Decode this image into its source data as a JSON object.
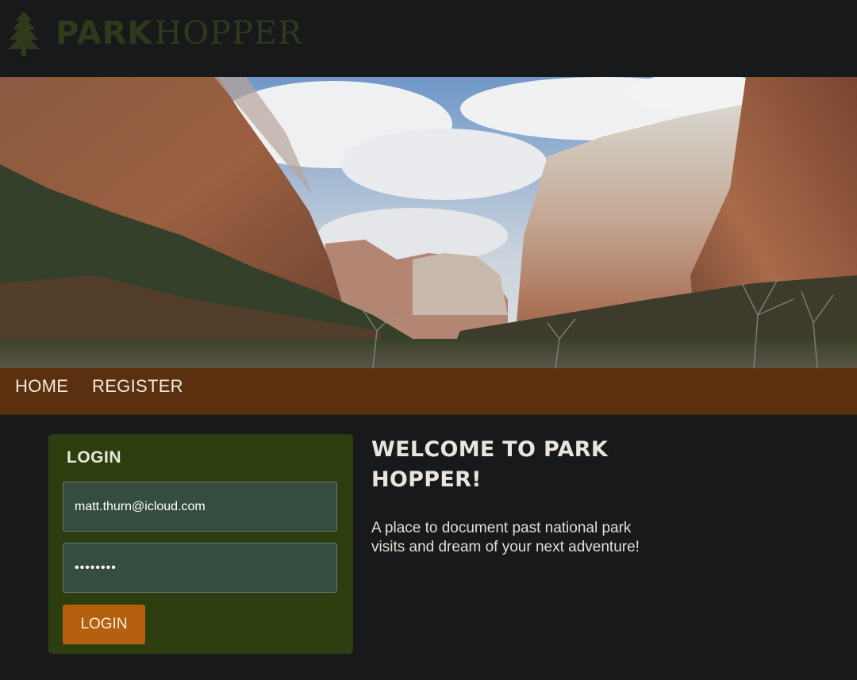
{
  "brand": {
    "logo_text_bold": "PARK",
    "logo_text_serif": "HOPPER",
    "logo_icon": "pine-tree-icon",
    "color": "#2e3a1b"
  },
  "hero": {
    "image": "canyon-landscape-photo"
  },
  "nav": {
    "items": [
      {
        "label": "HOME"
      },
      {
        "label": "REGISTER"
      }
    ],
    "background": "#5b300e"
  },
  "login": {
    "title": "LOGIN",
    "email_value": "matt.thurn@icloud.com",
    "password_value": "••••••••",
    "button_label": "LOGIN",
    "card_color": "#2c3e10",
    "button_color": "#b5600e"
  },
  "welcome": {
    "title": "WELCOME TO PARK HOPPER!",
    "text": "A place to document past national park visits and dream of your next adventure!"
  }
}
